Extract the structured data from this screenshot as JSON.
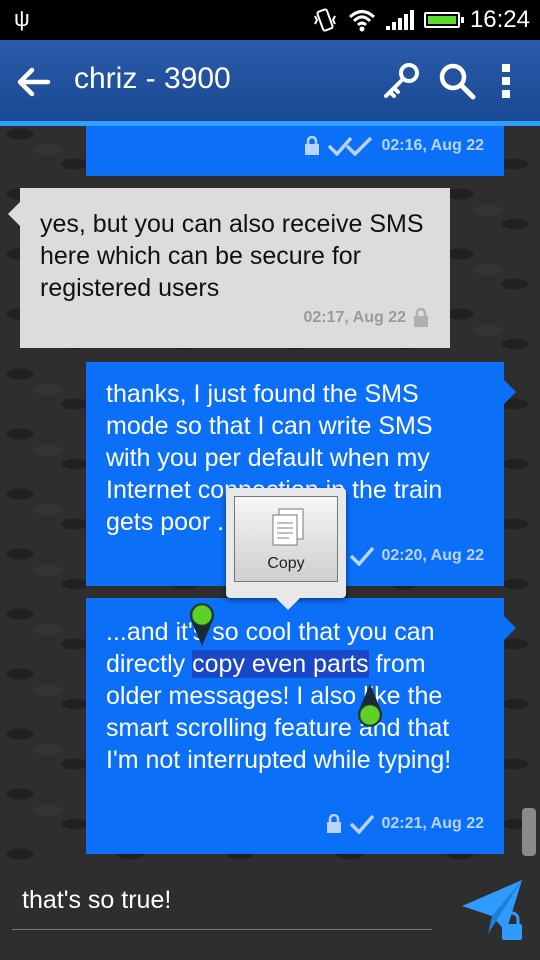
{
  "status_bar": {
    "time": "16:24"
  },
  "header": {
    "title": "chriz - 3900"
  },
  "messages": [
    {
      "direction": "out",
      "text": "",
      "time": "02:16, Aug 22"
    },
    {
      "direction": "in",
      "text": "yes, but you can also receive SMS here which can be secure for registered users",
      "time": "02:17, Aug 22"
    },
    {
      "direction": "out",
      "lines": [
        "thanks, I just found the SMS",
        "mode so that I can write SMS",
        "with you per default when my",
        "Internet connection in the train",
        "gets poor ... amazing!"
      ],
      "time": "02:20, Aug 22"
    },
    {
      "direction": "out",
      "before": "...and it's so cool that you can directly ",
      "selected": "copy even parts",
      "after": " from older messages! I also like the smart scrolling feature and that I'm not interrupted while typing!",
      "time": "02:21, Aug 22"
    }
  ],
  "context_popup": {
    "copy_label": "Copy"
  },
  "composer": {
    "input_value": "that's so true!"
  },
  "colors": {
    "header": "#1f4f9d",
    "accent": "#2fa0ff",
    "outgoing_bubble": "#0c6ff8",
    "incoming_bubble": "#dcdcdc"
  }
}
